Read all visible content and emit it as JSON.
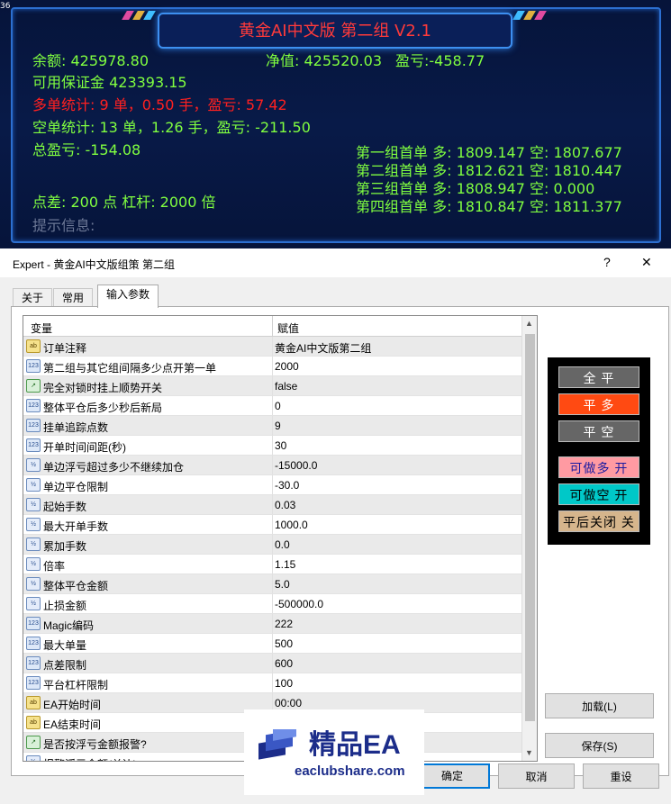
{
  "dashboard": {
    "corner_number": "36",
    "title": "黄金AI中文版 第二组 V2.1",
    "balance": "余额: 425978.80",
    "equity": "净值: 425520.03",
    "profit": "盈亏:-458.77",
    "free_margin": "可用保证金 423393.15",
    "buy_stats": "多单统计: 9 单，0.50 手，盈亏: 57.42",
    "sell_stats": "空单统计: 13 单，1.26 手，盈亏: -211.50",
    "total_profit": "总盈亏: -154.08",
    "group1": "第一组首单 多: 1809.147 空: 1807.677",
    "group2": "第二组首单 多: 1812.621 空: 1810.447",
    "group3": "第三组首单 多: 1808.947 空: 0.000",
    "group4": "第四组首单 多: 1810.847 空: 1811.377",
    "spread_leverage": "点差: 200 点   杠杆: 2000 倍",
    "hint": "提示信息:"
  },
  "dialog": {
    "title": "Expert - 黄金AI中文版组策 第二组",
    "help": "?",
    "close": "✕",
    "tabs": [
      "关于",
      "常用",
      "输入参数"
    ],
    "active_tab": "输入参数",
    "grid": {
      "col_variable": "变量",
      "col_value": "赋值",
      "rows": [
        {
          "icon": "ab",
          "name": "订单注释",
          "value": "黄金AI中文版第二组"
        },
        {
          "icon": "123",
          "name": "第二组与其它组间隔多少点开第一单",
          "value": "2000"
        },
        {
          "icon": "bool",
          "name": "完全对锁时挂上顺势开关",
          "value": "false"
        },
        {
          "icon": "123",
          "name": "整体平仓后多少秒后新局",
          "value": "0"
        },
        {
          "icon": "123",
          "name": "挂单追踪点数",
          "value": "9"
        },
        {
          "icon": "123",
          "name": "开单时间间距(秒)",
          "value": "30"
        },
        {
          "icon": "v2",
          "name": "单边浮亏超过多少不继续加仓",
          "value": "-15000.0"
        },
        {
          "icon": "v2",
          "name": "单边平仓限制",
          "value": "-30.0"
        },
        {
          "icon": "v2",
          "name": "起始手数",
          "value": "0.03"
        },
        {
          "icon": "v2",
          "name": "最大开单手数",
          "value": "1000.0"
        },
        {
          "icon": "v2",
          "name": "累加手数",
          "value": "0.0"
        },
        {
          "icon": "v2",
          "name": "倍率",
          "value": "1.15"
        },
        {
          "icon": "v2",
          "name": "整体平仓金额",
          "value": "5.0"
        },
        {
          "icon": "v2",
          "name": "止损金额",
          "value": "-500000.0"
        },
        {
          "icon": "123",
          "name": "Magic编码",
          "value": "222"
        },
        {
          "icon": "123",
          "name": "最大单量",
          "value": "500"
        },
        {
          "icon": "123",
          "name": "点差限制",
          "value": "600"
        },
        {
          "icon": "123",
          "name": "平台杠杆限制",
          "value": "100"
        },
        {
          "icon": "ab",
          "name": "EA开始时间",
          "value": "00:00"
        },
        {
          "icon": "ab",
          "name": "EA结束时间",
          "value": "23:59"
        },
        {
          "icon": "bool",
          "name": "是否按浮亏金额报警?",
          "value": ""
        },
        {
          "icon": "v2",
          "name": "报警浮亏金额(单边)",
          "value": ""
        }
      ]
    },
    "control_panel": {
      "close_all": "全 平",
      "close_buy": "平 多",
      "close_sell": "平 空",
      "can_buy": "可做多 开",
      "can_sell": "可做空 开",
      "close_after": "平后关闭 关"
    },
    "load_button": "加载(L)",
    "save_button": "保存(S)",
    "ok_button": "确定",
    "cancel_button": "取消",
    "reset_button": "重设"
  },
  "watermark": {
    "brand": "精品EA",
    "domain": "eaclubshare.com"
  },
  "colors": {
    "dash_green": "#80ff40",
    "dash_red": "#ff2020",
    "btn_orange": "#ff4a12",
    "btn_gray": "#666666",
    "btn_pink": "#ff9aa2",
    "btn_cyan": "#00c8c8",
    "btn_tan": "#d6b58c"
  }
}
